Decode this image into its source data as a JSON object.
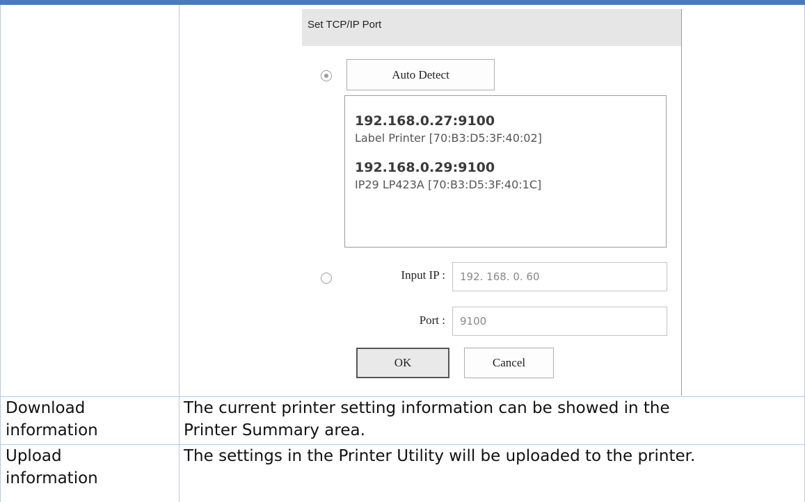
{
  "dialog": {
    "title": "Set TCP/IP Port",
    "auto_detect_label": "Auto Detect",
    "detected_printers": [
      {
        "address": "192.168.0.27:9100",
        "description": "Label Printer [70:B3:D5:3F:40:02]"
      },
      {
        "address": "192.168.0.29:9100",
        "description": "IP29 LP423A [70:B3:D5:3F:40:1C]"
      }
    ],
    "input_ip_label": "Input IP :",
    "input_ip_value": "192. 168. 0. 60",
    "port_label": "Port :",
    "port_value": "9100",
    "ok_label": "OK",
    "cancel_label": "Cancel"
  },
  "table": {
    "rows": [
      {
        "name_line1": "Download",
        "name_line2": "information",
        "desc_line1": "The current printer setting information can be showed in the",
        "desc_line2": "Printer Summary area."
      },
      {
        "name_line1": "Upload",
        "name_line2": "information",
        "desc_line1": "The settings in the Printer Utility will be uploaded to the printer.",
        "desc_line2": ""
      }
    ]
  },
  "colors": {
    "top_rule": "#4a7ab8",
    "table_border": "#b8c9e2"
  }
}
